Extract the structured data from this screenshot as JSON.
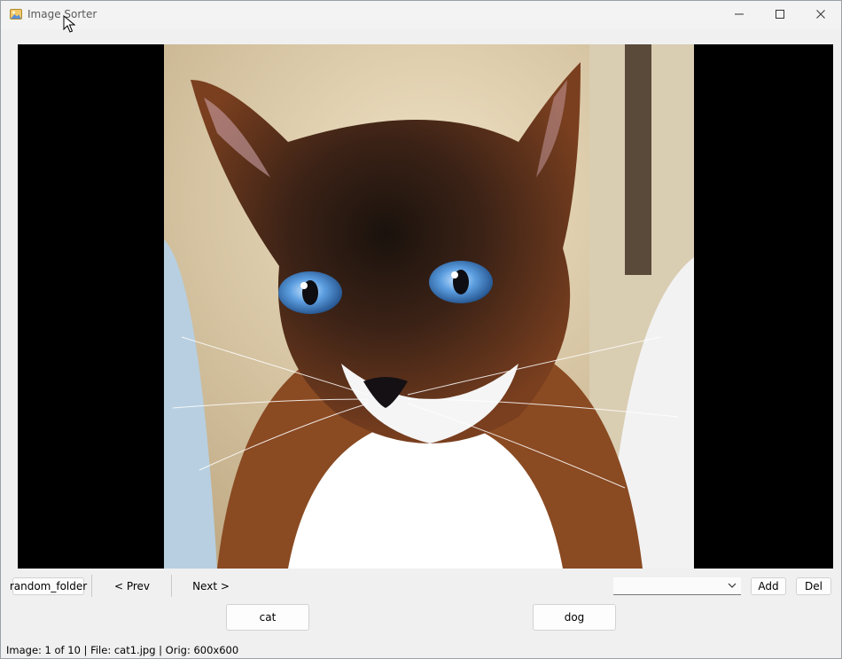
{
  "window": {
    "title": "Image Sorter"
  },
  "toolbar": {
    "folder_label": "random_folder",
    "prev_label": "< Prev",
    "next_label": "Next >",
    "category_select_value": "",
    "add_label": "Add",
    "del_label": "Del"
  },
  "categories": [
    "cat",
    "dog"
  ],
  "status": {
    "text": "Image: 1 of 10 | File: cat1.jpg | Orig: 600x600"
  },
  "icons": {
    "app": "image-icon",
    "minimize": "minimize-icon",
    "maximize": "maximize-icon",
    "close": "close-icon"
  }
}
